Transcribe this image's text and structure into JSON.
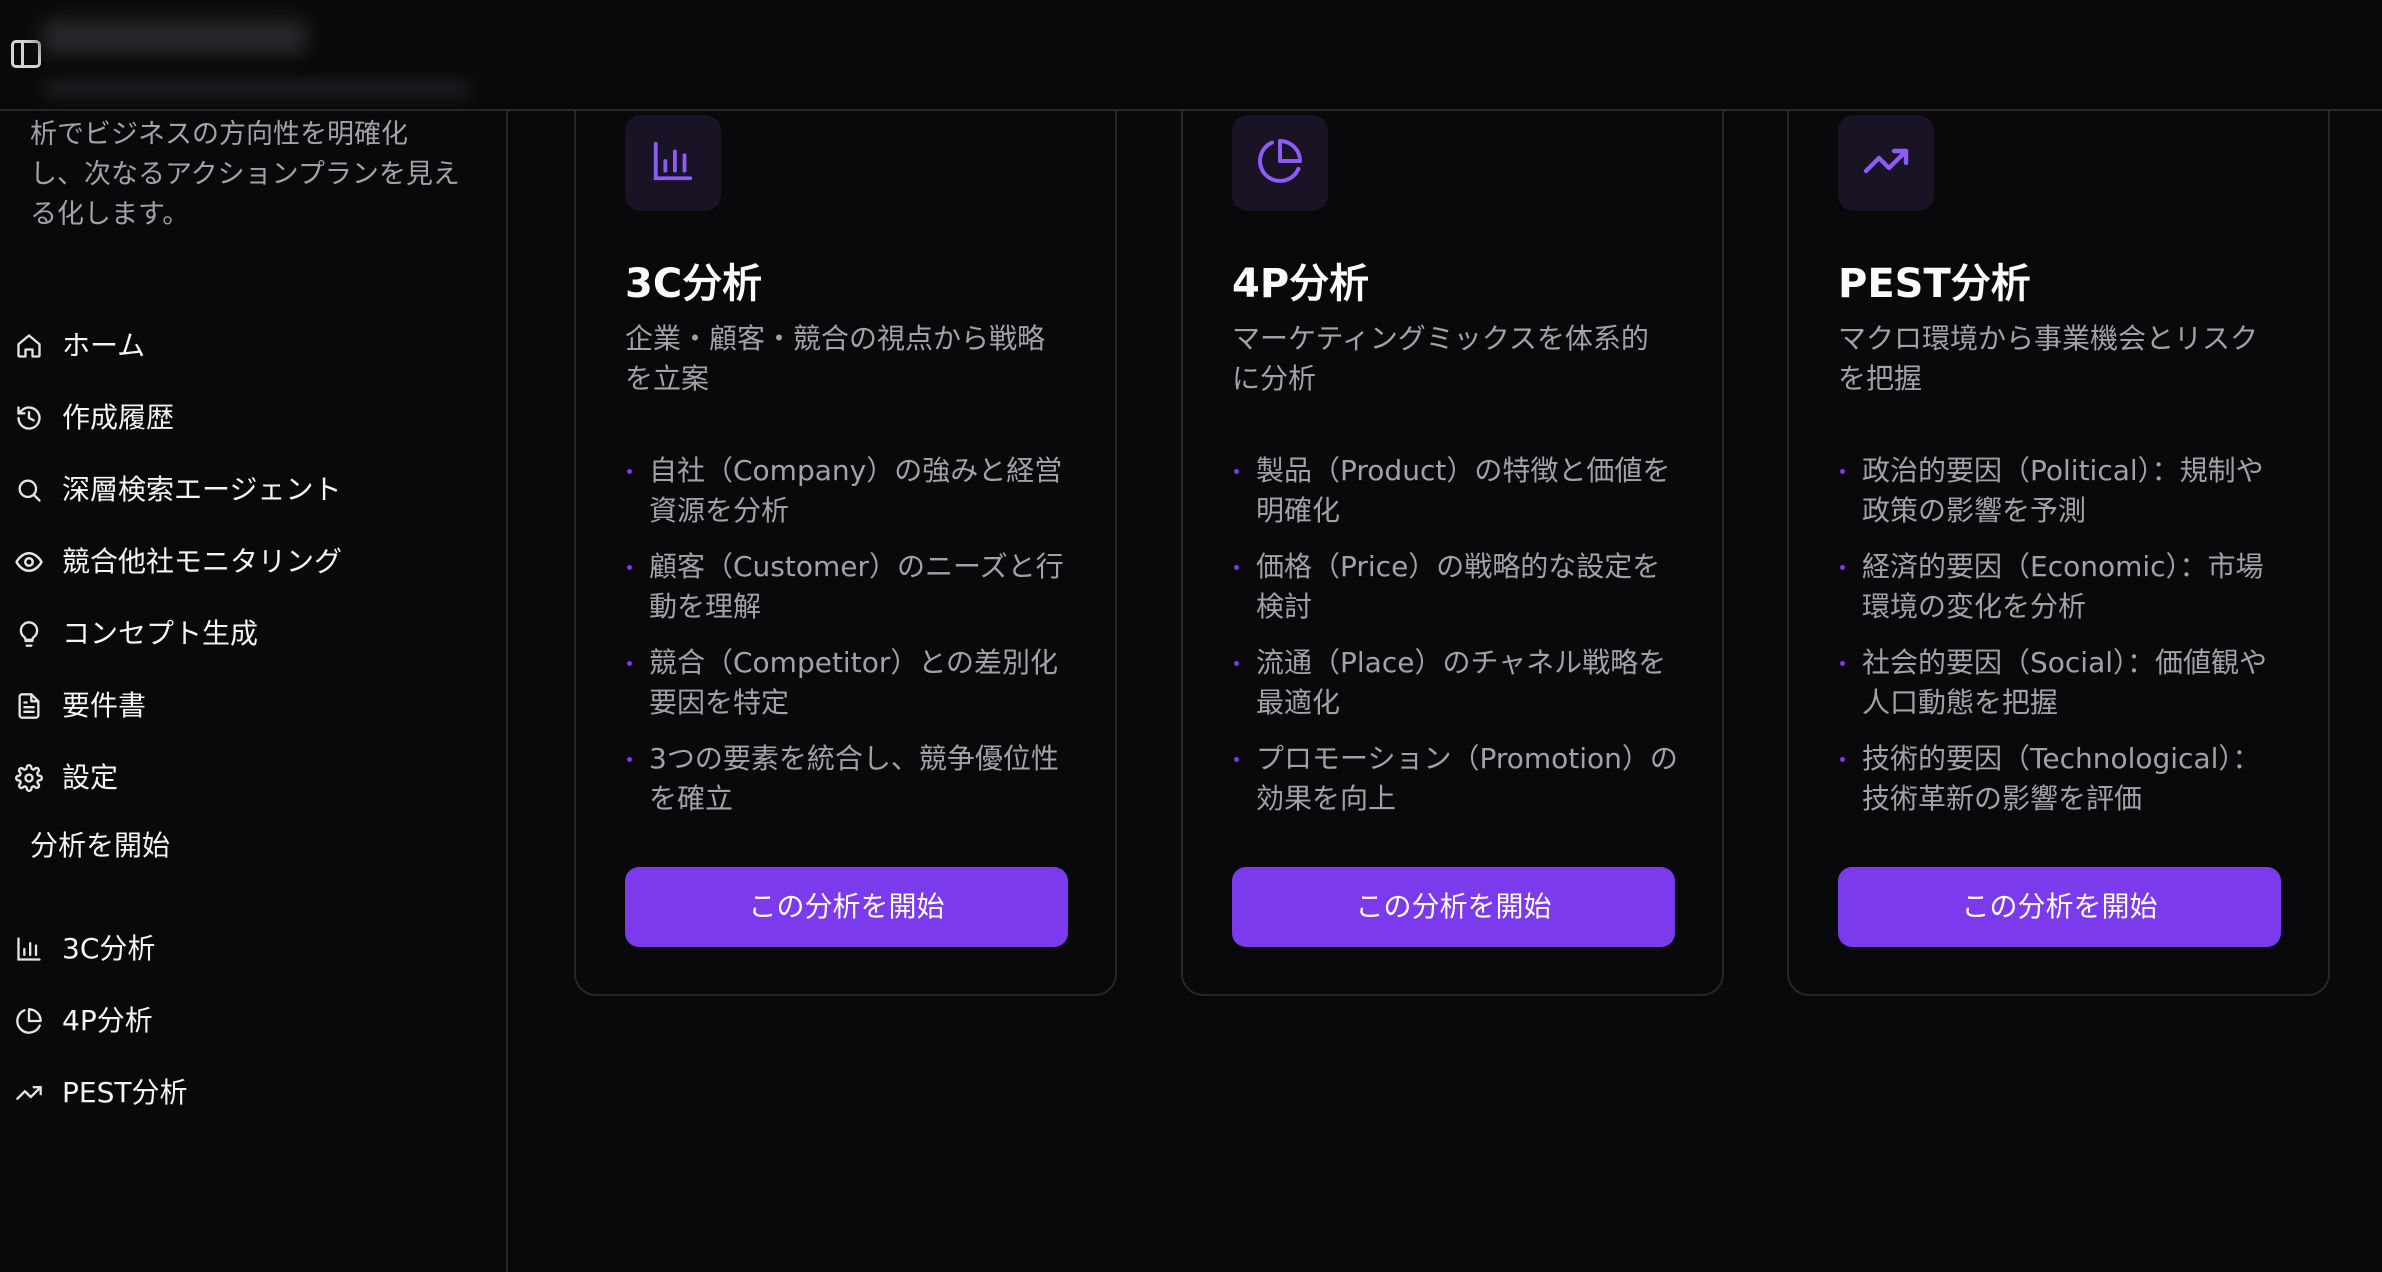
{
  "sidebar": {
    "description": "析でビジネスの方向性を明確化し、次なるアクションプランを見える化します。",
    "nav": [
      {
        "label": "ホーム",
        "icon": "home-icon"
      },
      {
        "label": "作成履歴",
        "icon": "history-icon"
      },
      {
        "label": "深層検索エージェント",
        "icon": "search-icon"
      },
      {
        "label": "競合他社モニタリング",
        "icon": "eye-icon"
      },
      {
        "label": "コンセプト生成",
        "icon": "lightbulb-icon"
      },
      {
        "label": "要件書",
        "icon": "document-icon"
      },
      {
        "label": "設定",
        "icon": "gear-icon"
      }
    ],
    "section_label": "分析を開始",
    "analysis": [
      {
        "label": "3C分析",
        "icon": "bar-chart-icon"
      },
      {
        "label": "4P分析",
        "icon": "pie-chart-icon"
      },
      {
        "label": "PEST分析",
        "icon": "trending-up-icon"
      }
    ]
  },
  "cards": [
    {
      "title": "3C分析",
      "icon": "bar-chart-icon",
      "description": "企業・顧客・競合の視点から戦略を立案",
      "bullets": [
        "自社（Company）の強みと経営資源を分析",
        "顧客（Customer）のニーズと行動を理解",
        "競合（Competitor）との差別化要因を特定",
        "3つの要素を統合し、競争優位性を確立"
      ],
      "button": "この分析を開始"
    },
    {
      "title": "4P分析",
      "icon": "pie-chart-icon",
      "description": "マーケティングミックスを体系的に分析",
      "bullets": [
        "製品（Product）の特徴と価値を明確化",
        "価格（Price）の戦略的な設定を検討",
        "流通（Place）のチャネル戦略を最適化",
        "プロモーション（Promotion）の効果を向上"
      ],
      "button": "この分析を開始"
    },
    {
      "title": "PEST分析",
      "icon": "trending-up-icon",
      "description": "マクロ環境から事業機会とリスクを把握",
      "bullets": [
        "政治的要因（Political）：規制や政策の影響を予測",
        "経済的要因（Economic）：市場環境の変化を分析",
        "社会的要因（Social）：価値観や人口動態を把握",
        "技術的要因（Technological）：技術革新の影響を評価"
      ],
      "button": "この分析を開始"
    }
  ],
  "colors": {
    "background": "#09090b",
    "accent": "#7c3aed",
    "border": "#27272a",
    "muted_text": "#a1a1aa"
  }
}
